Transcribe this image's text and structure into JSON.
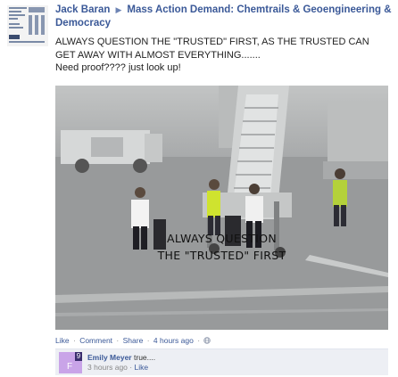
{
  "post": {
    "author": "Jack Baran",
    "arrow_glyph": "▶",
    "group_name": "Mass Action Demand: Chemtrails & Geoengineering & Democracy",
    "message_lines": [
      "ALWAYS QUESTION THE \"TRUSTED\" FIRST, AS THE TRUSTED CAN",
      "GET AWAY WITH ALMOST EVERYTHING.......",
      "Need proof???? just look up!"
    ],
    "photo_overlay": {
      "line1": "ALWAYS QUESTION",
      "line2": "THE \"TRUSTED\" FIRST"
    },
    "actions": {
      "like": "Like",
      "comment": "Comment",
      "share": "Share",
      "separator": "·",
      "time": "4 hours ago",
      "audience_icon": "globe-icon"
    }
  },
  "comment": {
    "avatar_badge": "9",
    "avatar_letter": "F",
    "author": "Emily Meyer",
    "text": "true....",
    "time": "3 hours ago",
    "like": "Like"
  },
  "colors": {
    "link": "#3b5998",
    "comment_bg": "#edeff4",
    "comment_avatar": "#c9a4e8"
  }
}
